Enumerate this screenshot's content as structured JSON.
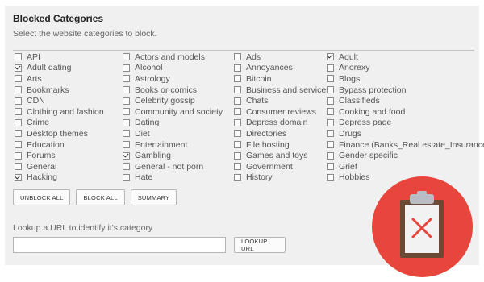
{
  "header": {
    "title": "Blocked Categories",
    "subtitle": "Select the website categories to block."
  },
  "categories": [
    [
      {
        "label": "API",
        "checked": false
      },
      {
        "label": "Adult dating",
        "checked": true
      },
      {
        "label": "Arts",
        "checked": false
      },
      {
        "label": "Bookmarks",
        "checked": false
      },
      {
        "label": "CDN",
        "checked": false
      },
      {
        "label": "Clothing and fashion",
        "checked": false
      },
      {
        "label": "Crime",
        "checked": false
      },
      {
        "label": "Desktop themes",
        "checked": false
      },
      {
        "label": "Education",
        "checked": false
      },
      {
        "label": "Forums",
        "checked": false
      },
      {
        "label": "General",
        "checked": false
      },
      {
        "label": "Hacking",
        "checked": true
      }
    ],
    [
      {
        "label": "Actors and models",
        "checked": false
      },
      {
        "label": "Alcohol",
        "checked": false
      },
      {
        "label": "Astrology",
        "checked": false
      },
      {
        "label": "Books or comics",
        "checked": false
      },
      {
        "label": "Celebrity gossip",
        "checked": false
      },
      {
        "label": "Community and society",
        "checked": false
      },
      {
        "label": "Dating",
        "checked": false
      },
      {
        "label": "Diet",
        "checked": false
      },
      {
        "label": "Entertainment",
        "checked": false
      },
      {
        "label": "Gambling",
        "checked": true
      },
      {
        "label": "General - not porn",
        "checked": false
      },
      {
        "label": "Hate",
        "checked": false
      }
    ],
    [
      {
        "label": "Ads",
        "checked": false
      },
      {
        "label": "Annoyances",
        "checked": false
      },
      {
        "label": "Bitcoin",
        "checked": false
      },
      {
        "label": "Business and services",
        "checked": false
      },
      {
        "label": "Chats",
        "checked": false
      },
      {
        "label": "Consumer reviews",
        "checked": false
      },
      {
        "label": "Depress domain",
        "checked": false
      },
      {
        "label": "Directories",
        "checked": false
      },
      {
        "label": "File hosting",
        "checked": false
      },
      {
        "label": "Games and toys",
        "checked": false
      },
      {
        "label": "Government",
        "checked": false
      },
      {
        "label": "History",
        "checked": false
      }
    ],
    [
      {
        "label": "Adult",
        "checked": true
      },
      {
        "label": "Anorexy",
        "checked": false
      },
      {
        "label": "Blogs",
        "checked": false
      },
      {
        "label": "Bypass protection",
        "checked": false
      },
      {
        "label": "Classifieds",
        "checked": false
      },
      {
        "label": "Cooking and food",
        "checked": false
      },
      {
        "label": "Depress page",
        "checked": false
      },
      {
        "label": "Drugs",
        "checked": false
      },
      {
        "label": "Finance (Banks_Real estate_Insurance)",
        "checked": false
      },
      {
        "label": "Gender specific",
        "checked": false
      },
      {
        "label": "Grief",
        "checked": false
      },
      {
        "label": "Hobbies",
        "checked": false
      }
    ]
  ],
  "buttons": {
    "unblock_all": "UNBLOCK ALL",
    "block_all": "BLOCK ALL",
    "summary": "SUMMARY"
  },
  "lookup": {
    "label": "Lookup a URL to identify it's category",
    "value": "",
    "placeholder": "",
    "button": "LOOKUP URL"
  },
  "badge": {
    "icon": "clipboard-x-icon",
    "color": "#e8463d"
  }
}
